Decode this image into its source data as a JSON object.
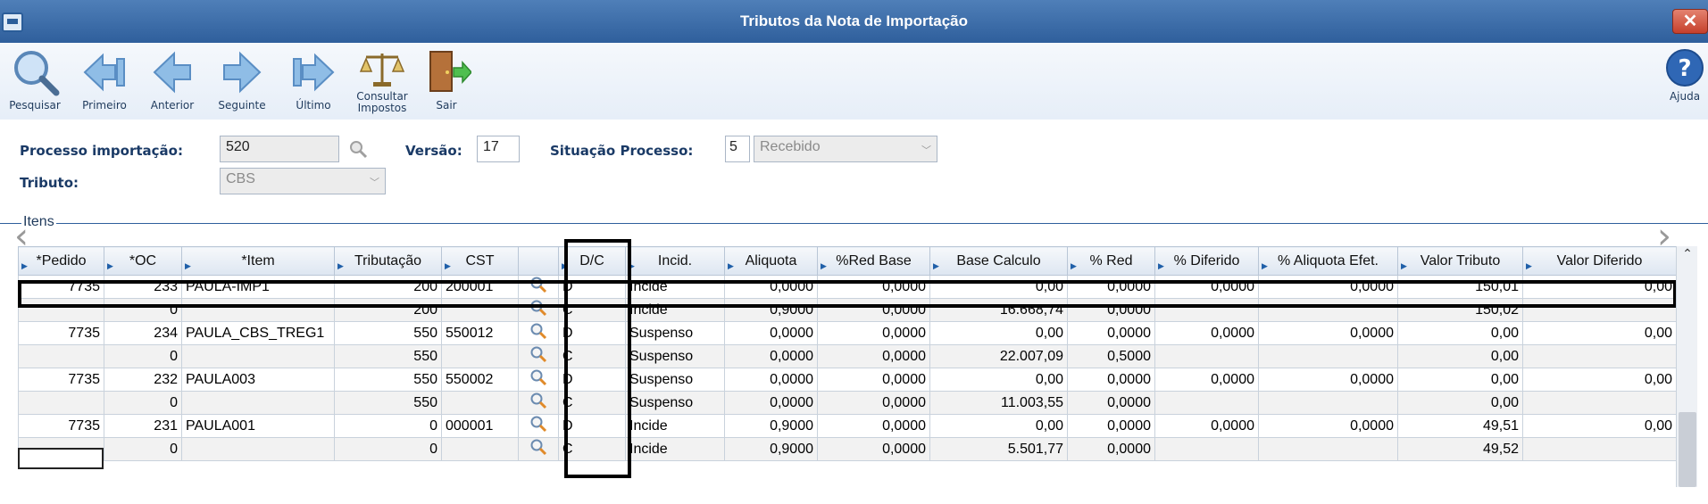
{
  "window": {
    "title": "Tributos da Nota de Importação",
    "close_label": "✕"
  },
  "toolbar": {
    "items": [
      {
        "label": "Pesquisar",
        "icon": "search-icon"
      },
      {
        "label": "Primeiro",
        "icon": "first-arrow-icon"
      },
      {
        "label": "Anterior",
        "icon": "previous-arrow-icon"
      },
      {
        "label": "Seguinte",
        "icon": "next-arrow-icon"
      },
      {
        "label": "Último",
        "icon": "last-arrow-icon"
      },
      {
        "label": "Consultar Impostos",
        "icon": "scales-icon"
      },
      {
        "label": "Sair",
        "icon": "exit-door-icon"
      }
    ],
    "help_label": "Ajuda",
    "help_glyph": "?"
  },
  "form": {
    "processo_label": "Processo importação:",
    "processo_value": "520",
    "versao_label": "Versão:",
    "versao_value": "17",
    "situacao_label": "Situação Processo:",
    "situacao_code": "5",
    "situacao_value": "Recebido",
    "tributo_label": "Tributo:",
    "tributo_value": "CBS"
  },
  "group": {
    "label": "Itens"
  },
  "grid": {
    "columns": [
      "*Pedido",
      "*OC",
      "*Item",
      "Tributação",
      "CST",
      "",
      "D/C",
      "Incid.",
      "Aliquota",
      "%Red Base",
      "Base Calculo",
      "% Red",
      "% Diferido",
      "% Aliquota Efet.",
      "Valor Tributo",
      "Valor Diferido"
    ],
    "rows": [
      [
        "7735",
        "233",
        "PAULA-IMP1",
        "200",
        "200001",
        "D",
        "Incide",
        "0,0000",
        "0,0000",
        "0,00",
        "0,0000",
        "0,0000",
        "0,0000",
        "150,01",
        "0,00"
      ],
      [
        "",
        "0",
        "",
        "200",
        "",
        "C",
        "Incide",
        "0,9000",
        "0,0000",
        "16.668,74",
        "0,0000",
        "",
        "",
        "150,02",
        ""
      ],
      [
        "7735",
        "234",
        "PAULA_CBS_TREG1",
        "550",
        "550012",
        "D",
        "Suspenso",
        "0,0000",
        "0,0000",
        "0,00",
        "0,0000",
        "0,0000",
        "0,0000",
        "0,00",
        "0,00"
      ],
      [
        "",
        "0",
        "",
        "550",
        "",
        "C",
        "Suspenso",
        "0,0000",
        "0,0000",
        "22.007,09",
        "0,5000",
        "",
        "",
        "0,00",
        ""
      ],
      [
        "7735",
        "232",
        "PAULA003",
        "550",
        "550002",
        "D",
        "Suspenso",
        "0,0000",
        "0,0000",
        "0,00",
        "0,0000",
        "0,0000",
        "0,0000",
        "0,00",
        "0,00"
      ],
      [
        "",
        "0",
        "",
        "550",
        "",
        "C",
        "Suspenso",
        "0,0000",
        "0,0000",
        "11.003,55",
        "0,0000",
        "",
        "",
        "0,00",
        ""
      ],
      [
        "7735",
        "231",
        "PAULA001",
        "0",
        "000001",
        "D",
        "Incide",
        "0,9000",
        "0,0000",
        "0,00",
        "0,0000",
        "0,0000",
        "0,0000",
        "49,51",
        "0,00"
      ],
      [
        "",
        "0",
        "",
        "0",
        "",
        "C",
        "Incide",
        "0,9000",
        "0,0000",
        "5.501,77",
        "0,0000",
        "",
        "",
        "49,52",
        ""
      ]
    ]
  }
}
